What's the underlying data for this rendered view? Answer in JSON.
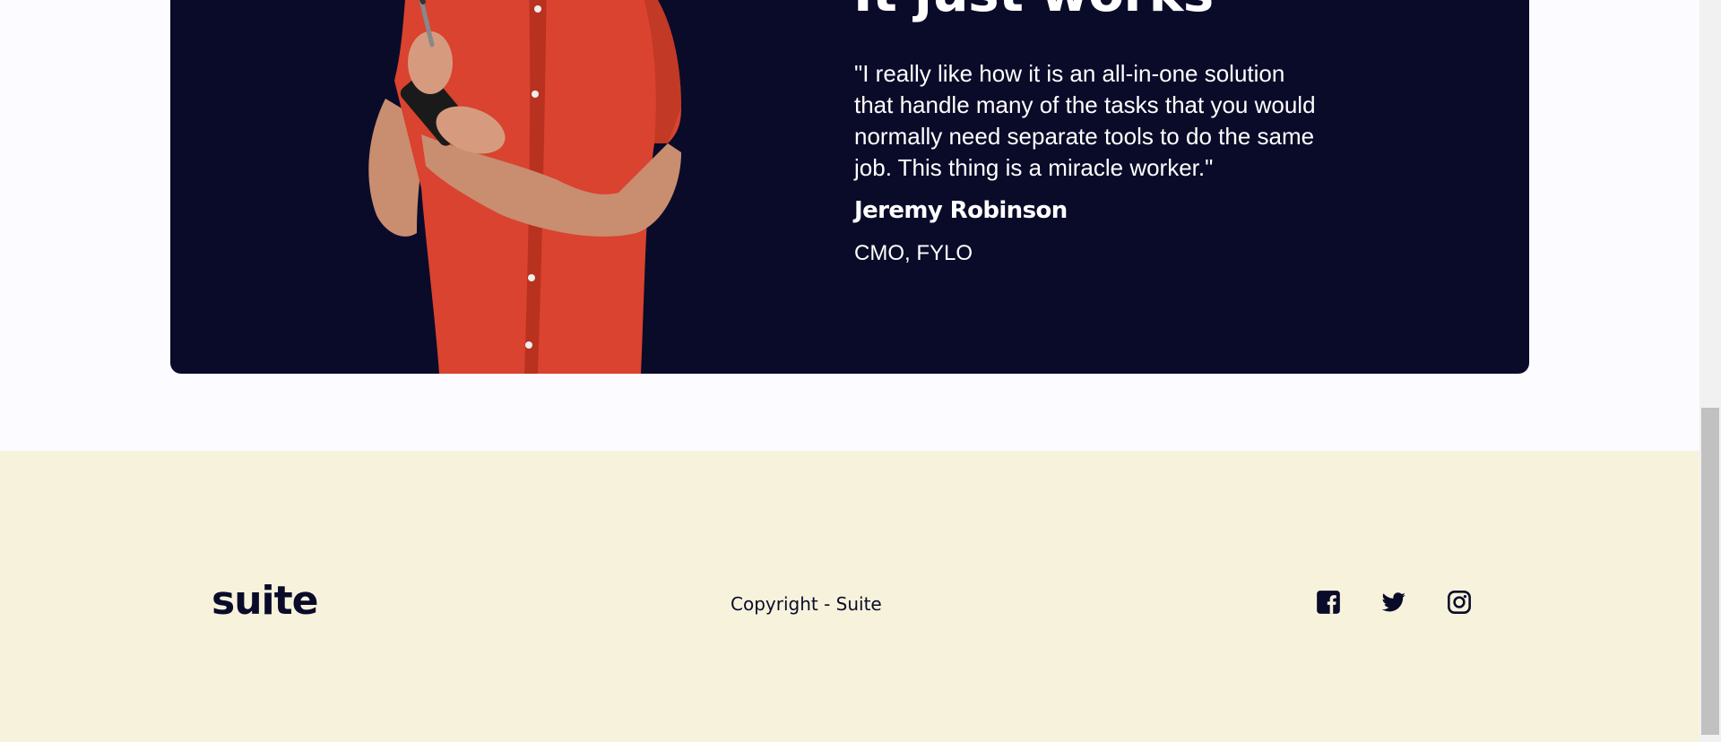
{
  "testimonial": {
    "heading": "It just works",
    "quote": "\"I really like how it is an all-in-one solution that handle many of the tasks that you would normally need separate tools to do the same job. This thing is a miracle worker.\"",
    "author": "Jeremy Robinson",
    "role": "CMO, FYLO",
    "image_icon": "person-photo"
  },
  "footer": {
    "logo": "suite",
    "copyright": "Copyright - Suite",
    "social_icons": [
      "facebook-icon",
      "twitter-icon",
      "instagram-icon"
    ]
  },
  "colors": {
    "dark_navy": "#0a0b29",
    "footer_bg": "#f7f2dc",
    "page_bg": "#fcfbff",
    "shirt_red": "#d9432f"
  }
}
